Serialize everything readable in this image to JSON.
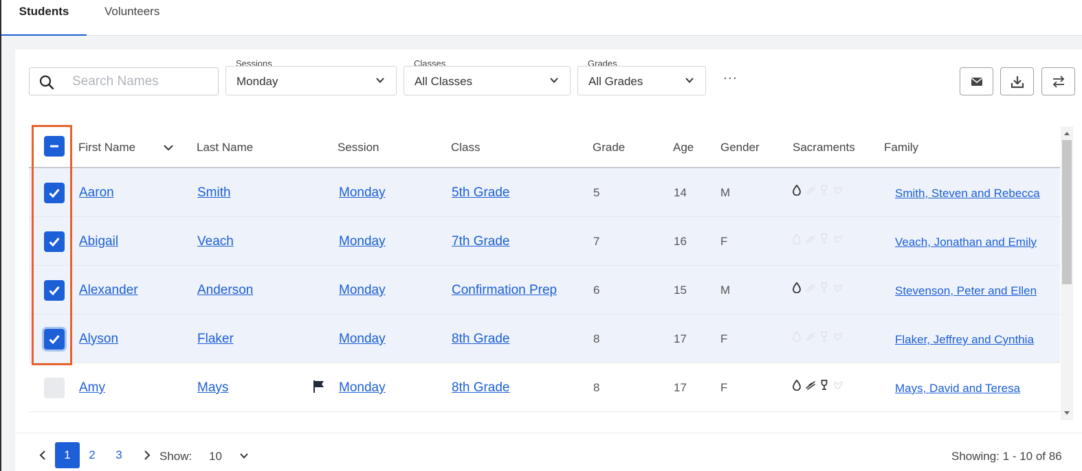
{
  "tabs": {
    "students": "Students",
    "volunteers": "Volunteers"
  },
  "filters": {
    "search_placeholder": "Search Names",
    "sessions": {
      "label": "Sessions",
      "value": "Monday"
    },
    "classes": {
      "label": "Classes",
      "value": "All Classes"
    },
    "grades": {
      "label": "Grades",
      "value": "All Grades"
    },
    "more": "···"
  },
  "toolbar": {
    "icons": [
      "mail-icon",
      "download-icon",
      "swap-icon"
    ]
  },
  "table": {
    "headers": {
      "first_name": "First Name",
      "last_name": "Last Name",
      "session": "Session",
      "class": "Class",
      "grade": "Grade",
      "age": "Age",
      "gender": "Gender",
      "sacraments": "Sacraments",
      "family": "Family"
    },
    "header_checkbox_state": "indeterminate",
    "rows": [
      {
        "selected": true,
        "first": "Aaron",
        "last": "Smith",
        "flag": false,
        "session": "Monday",
        "class": "5th Grade",
        "grade": "5",
        "age": "14",
        "gender": "M",
        "sacraments": [
          true,
          false,
          false,
          false
        ],
        "family": "Smith, Steven and Rebecca"
      },
      {
        "selected": true,
        "first": "Abigail",
        "last": "Veach",
        "flag": false,
        "session": "Monday",
        "class": "7th Grade",
        "grade": "7",
        "age": "16",
        "gender": "F",
        "sacraments": [
          false,
          false,
          false,
          false
        ],
        "family": "Veach, Jonathan and Emily"
      },
      {
        "selected": true,
        "first": "Alexander",
        "last": "Anderson",
        "flag": false,
        "session": "Monday",
        "class": "Confirmation Prep",
        "grade": "6",
        "age": "15",
        "gender": "M",
        "sacraments": [
          true,
          false,
          false,
          false
        ],
        "family": "Stevenson, Peter and Ellen"
      },
      {
        "selected": true,
        "first": "Alyson",
        "last": "Flaker",
        "flag": false,
        "session": "Monday",
        "class": "8th Grade",
        "grade": "8",
        "age": "17",
        "gender": "F",
        "sacraments": [
          false,
          false,
          false,
          false
        ],
        "family": "Flaker, Jeffrey and Cynthia"
      },
      {
        "selected": false,
        "first": "Amy",
        "last": "Mays",
        "flag": true,
        "session": "Monday",
        "class": "8th Grade",
        "grade": "8",
        "age": "17",
        "gender": "F",
        "sacraments": [
          true,
          true,
          true,
          false
        ],
        "family": "Mays, David and Teresa"
      }
    ]
  },
  "pagination": {
    "pages": [
      "1",
      "2",
      "3"
    ],
    "current": "1",
    "show_label": "Show:",
    "show_value": "10",
    "showing": "Showing: 1 - 10 of 86"
  },
  "colors": {
    "accent": "#1d5fd6",
    "highlight": "#e8612b",
    "row_selected": "#eef3fb"
  }
}
